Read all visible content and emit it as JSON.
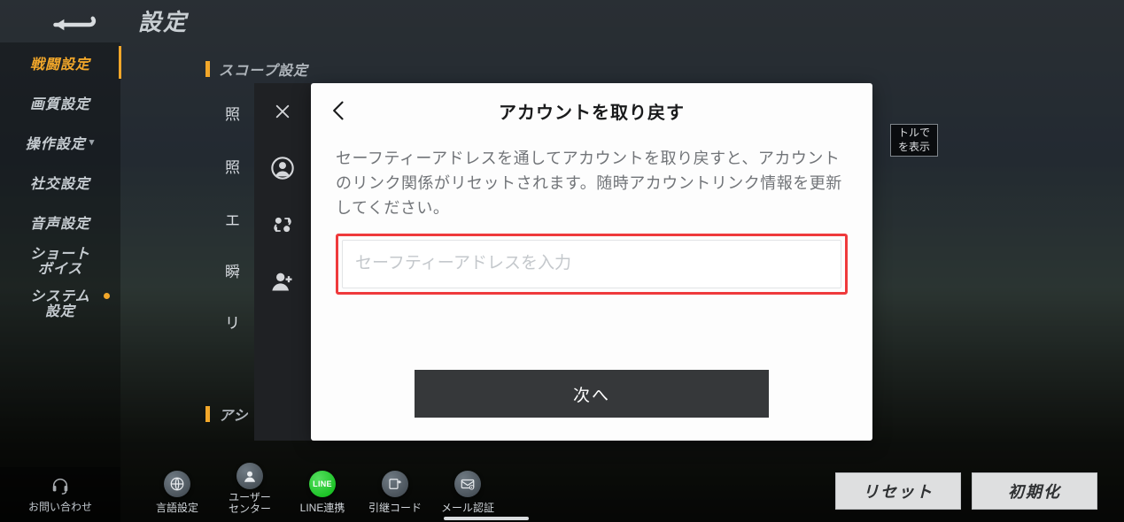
{
  "page_title": "設定",
  "sidebar": {
    "combat": "戦闘設定",
    "quality": "画質設定",
    "controls": "操作設定",
    "social": "社交設定",
    "audio": "音声設定",
    "short_voice_l1": "ショート",
    "short_voice_l2": "ボイス",
    "system_l1": "システム",
    "system_l2": "設定"
  },
  "contact_label": "お問い合わせ",
  "sections": {
    "scope": "スコープ設定",
    "assist": "アシ"
  },
  "bg_items": {
    "i0": "照",
    "i1": "照",
    "i2": "エ",
    "i3": "瞬",
    "i4": "リ"
  },
  "tip_box_l1": "トルで",
  "tip_box_l2": "を表示",
  "modal": {
    "title": "アカウントを取り戻す",
    "desc": "セーフティーアドレスを通してアカウントを取り戻すと、アカウントのリンク関係がリセットされます。随時アカウントリンク情報を更新してください。",
    "placeholder": "セーフティーアドレスを入力",
    "next": "次へ"
  },
  "bottom": {
    "lang": "言語設定",
    "user_l1": "ユーザー",
    "user_l2": "センター",
    "line": "LINE連携",
    "transfer": "引継コード",
    "mail": "メール認証"
  },
  "br": {
    "reset": "リセット",
    "init": "初期化"
  },
  "colors": {
    "accent": "#f2a72a",
    "highlight": "#ef3a3c"
  }
}
